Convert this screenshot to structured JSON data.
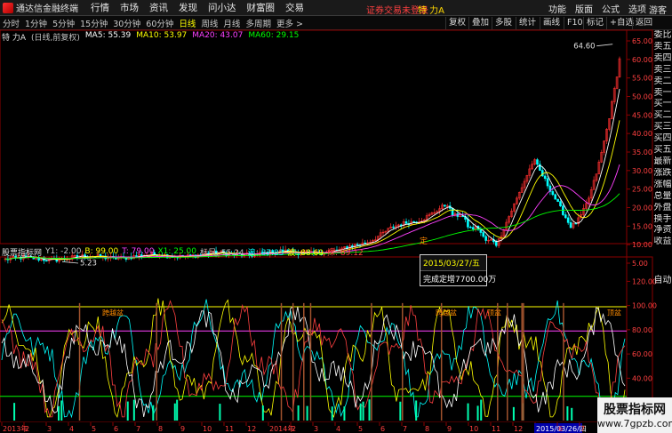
{
  "app": {
    "title": "通达信金融终端",
    "menu": [
      "行情",
      "市场",
      "资讯",
      "发现",
      "问小达",
      "财富圈",
      "交易"
    ],
    "login_status": "证券交易未登录",
    "stock_title": "特 力A",
    "right_menu": [
      "功能",
      "版面",
      "公式",
      "选项"
    ],
    "guest": "游客"
  },
  "period_bar": {
    "periods": [
      "分时",
      "1分钟",
      "5分钟",
      "15分钟",
      "30分钟",
      "60分钟",
      "日线",
      "周线",
      "月线",
      "多周期",
      "更多 >"
    ],
    "active": "日线",
    "tools": [
      "复权",
      "叠加",
      "多股",
      "统计",
      "画线",
      "F10",
      "标记",
      "+自选",
      "返回"
    ]
  },
  "main_chart": {
    "stock_label": "特 力A",
    "adjust_label": "(日线,前复权)",
    "ma": [
      {
        "label": "MA5: 55.39",
        "color": "#ffffff"
      },
      {
        "label": "MA10: 53.97",
        "color": "#ffff00"
      },
      {
        "label": "MA20: 43.07",
        "color": "#ff40ff"
      },
      {
        "label": "MA60: 29.15",
        "color": "#00ff00"
      }
    ],
    "high_label": "64.60",
    "low_label": "5.23",
    "event_marker": "定",
    "y_ticks": [
      "65.00",
      "60.00",
      "55.00",
      "50.00",
      "45.00",
      "40.00",
      "35.00",
      "30.00",
      "25.00",
      "20.00",
      "15.00",
      "10.00",
      "5.00"
    ]
  },
  "indicator": {
    "name": "股票指标网",
    "values": [
      {
        "label": "Y1: -2.00",
        "color": "#c0c0c0"
      },
      {
        "label": "B: 99.00",
        "color": "#ffff00"
      },
      {
        "label": "T: 79.00",
        "color": "#ff40ff"
      },
      {
        "label": "X1: 25.00",
        "color": "#00ff00"
      },
      {
        "label": "标尺: 55.24",
        "color": "#c0c0c0"
      },
      {
        "label": "浪: 87.83",
        "color": "#00ffff"
      },
      {
        "label": "波: 88.69",
        "color": "#ffff00"
      },
      {
        "label": "探: 89.12",
        "color": "#ff4040"
      }
    ],
    "y_ticks": [
      "120.00",
      "100.00",
      "80.00",
      "60.00",
      "40.00",
      "20.00"
    ],
    "annotations": [
      "跨越盆",
      "跨越盆",
      "顶盆",
      "顶盆"
    ]
  },
  "tooltip": {
    "date": "2015/03/27/五",
    "text": "完成定增7700.00万"
  },
  "side_panel": {
    "labels": [
      "委比",
      "卖五",
      "卖四",
      "卖三",
      "卖二",
      "卖一",
      "买一",
      "买二",
      "买三",
      "买四",
      "买五",
      "最新",
      "涨跌",
      "涨幅",
      "总量",
      "外盘",
      "换手",
      "净资",
      "收益"
    ],
    "auto": "自动"
  },
  "x_axis": {
    "labels": [
      "2013年",
      "2",
      "3",
      "4",
      "5",
      "6",
      "7",
      "8",
      "9",
      "10",
      "11",
      "12",
      "2014年",
      "2",
      "3",
      "4",
      "5",
      "6",
      "7",
      "8",
      "9",
      "10",
      "11",
      "12",
      "2015/03/26/四",
      "6",
      "7",
      "8",
      "9"
    ]
  },
  "watermark": {
    "line1": "股票指标网",
    "line2": "www.7gpzb.com"
  }
}
